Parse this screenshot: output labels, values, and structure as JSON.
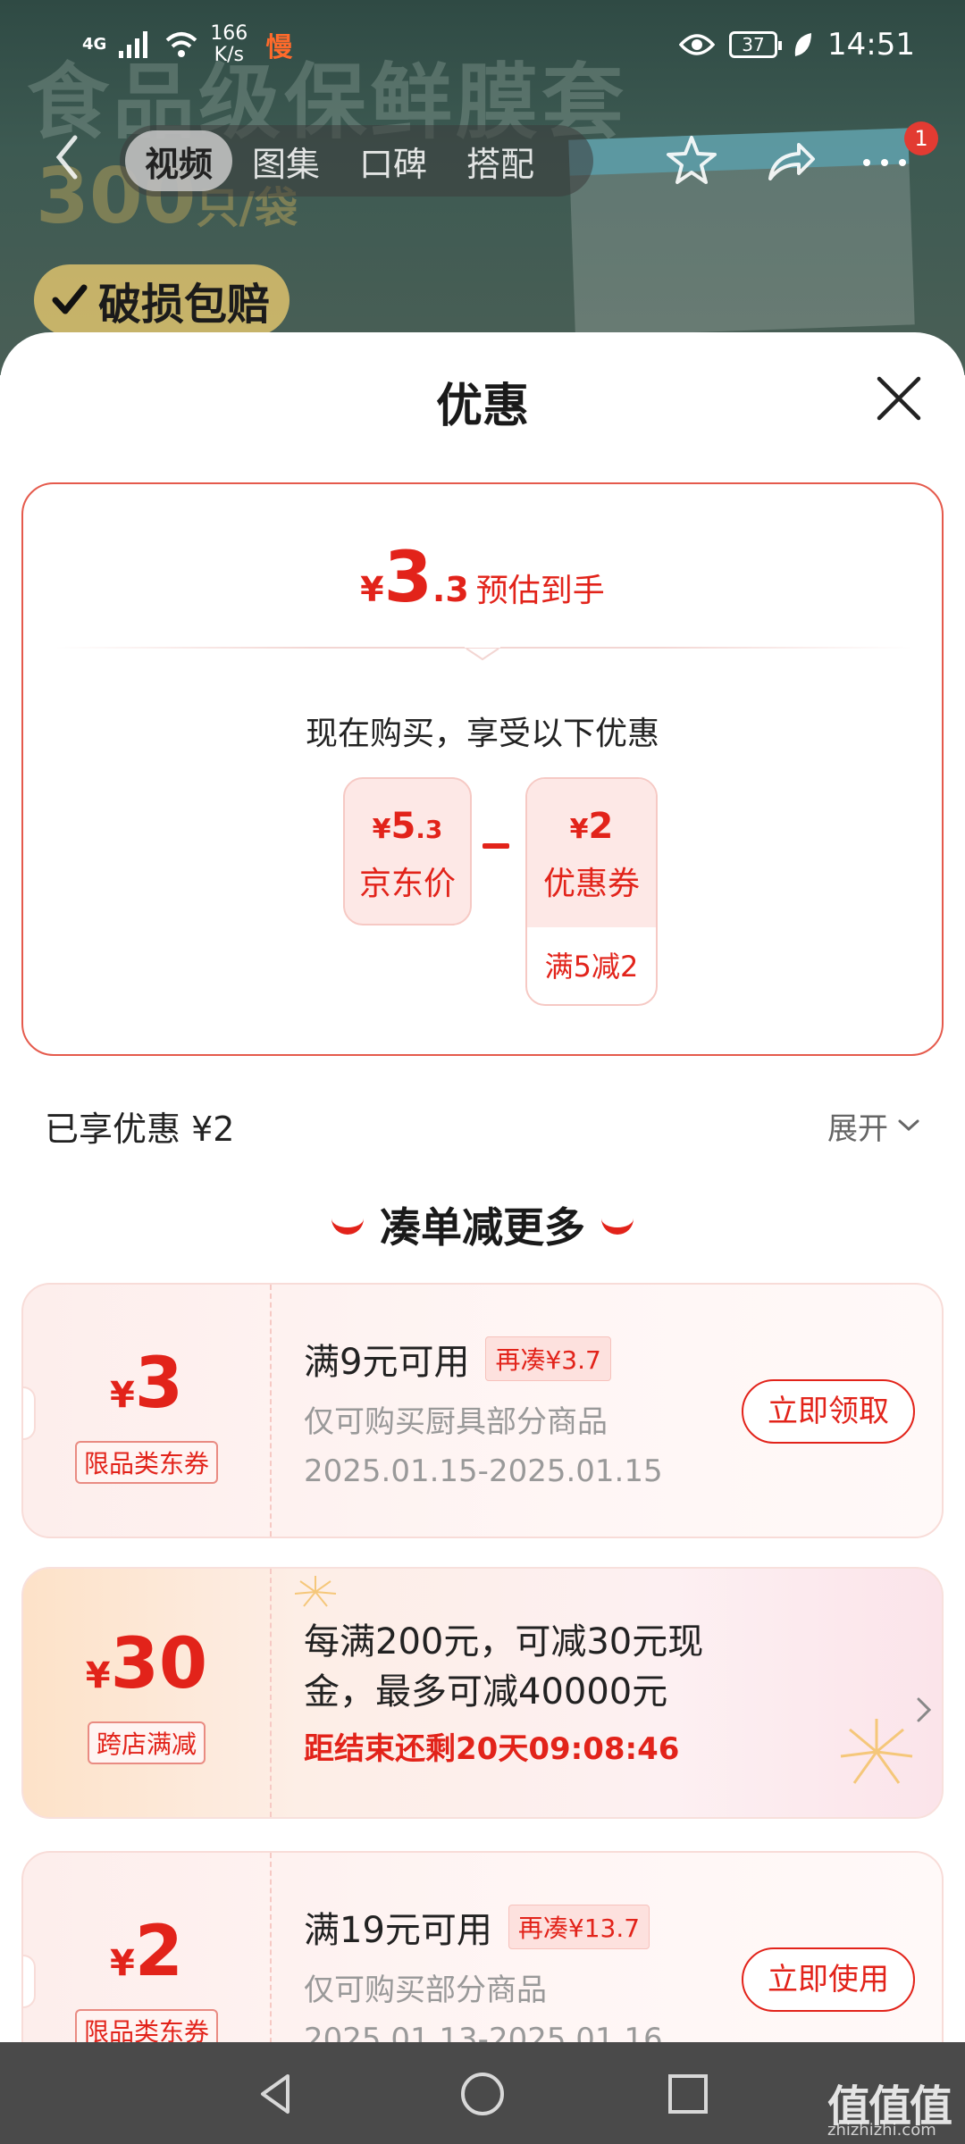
{
  "status": {
    "network": "4G",
    "speed": "166",
    "speed_unit": "K/s",
    "slow": "慢",
    "battery": "37",
    "time": "14:51"
  },
  "hero": {
    "headline": "食品级保鲜膜套",
    "count": "300",
    "count_unit": "只/袋",
    "badge": "破损包赔"
  },
  "nav": {
    "tabs": [
      "视频",
      "图集",
      "口碑",
      "搭配"
    ],
    "active_tab": "视频",
    "notification_count": "1"
  },
  "sheet": {
    "title": "优惠",
    "estimate": {
      "yen": "¥",
      "integer": "3",
      "decimal": ".3",
      "label": "预估到手"
    },
    "now_buy": "现在购买，享受以下优惠",
    "price_chip": {
      "yen": "¥",
      "integer": "5",
      "decimal": ".3",
      "label": "京东价"
    },
    "coupon_chip": {
      "yen": "¥",
      "amount": "2",
      "label": "优惠券",
      "condition": "满5减2"
    },
    "enjoyed": "已享优惠 ¥2",
    "expand": "展开",
    "more_title": "凑单减更多"
  },
  "coupons": [
    {
      "yen": "¥",
      "amount": "3",
      "tag": "限品类东券",
      "title": "满9元可用",
      "again": "再凑¥3.7",
      "subtitle": "仅可购买厨具部分商品",
      "date": "2025.01.15-2025.01.15",
      "button": "立即领取"
    },
    {
      "yen": "¥",
      "amount": "30",
      "tag": "跨店满减",
      "title_line1": "每满200元，可减30元现",
      "title_line2": "金，最多可减40000元",
      "countdown": "距结束还剩20天09:08:46"
    },
    {
      "yen": "¥",
      "amount": "2",
      "tag": "限品类东券",
      "title": "满19元可用",
      "again": "再凑¥13.7",
      "subtitle": "仅可购买部分商品",
      "date": "2025.01.13-2025.01.16",
      "button": "立即使用"
    }
  ],
  "watermark": {
    "logo": "值值值",
    "site": "zhizhizhi.com"
  },
  "colors": {
    "accent": "#e2231a",
    "hero_bg": "#3d5a52",
    "nav_bar": "#4a4a4a"
  }
}
